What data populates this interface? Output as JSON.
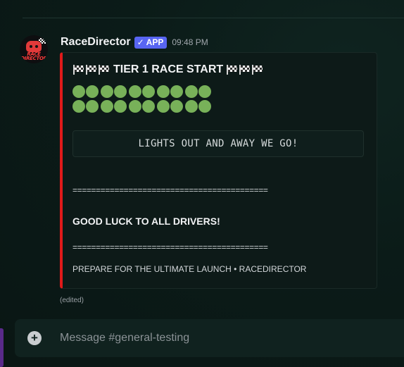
{
  "message": {
    "username": "RaceDirector",
    "badge": "APP",
    "badge_check": "✓",
    "timestamp": "09:48 PM",
    "avatar_text": "RACE DIRECTOR",
    "edited": "(edited)"
  },
  "embed": {
    "title": "TIER 1 RACE START",
    "accent_color": "#e01a1a",
    "lights_color": "#78b159",
    "lights_rows": 2,
    "lights_per_row": 10,
    "code_text": "LIGHTS OUT AND AWAY WE GO!",
    "separator_1": "==========================================",
    "good_luck": "GOOD LUCK TO ALL DRIVERS!",
    "separator_2": "==========================================",
    "footer": "PREPARE FOR THE ULTIMATE LAUNCH • RACEDIRECTOR"
  },
  "composer": {
    "placeholder": "Message #general-testing",
    "plus_icon": "+"
  }
}
